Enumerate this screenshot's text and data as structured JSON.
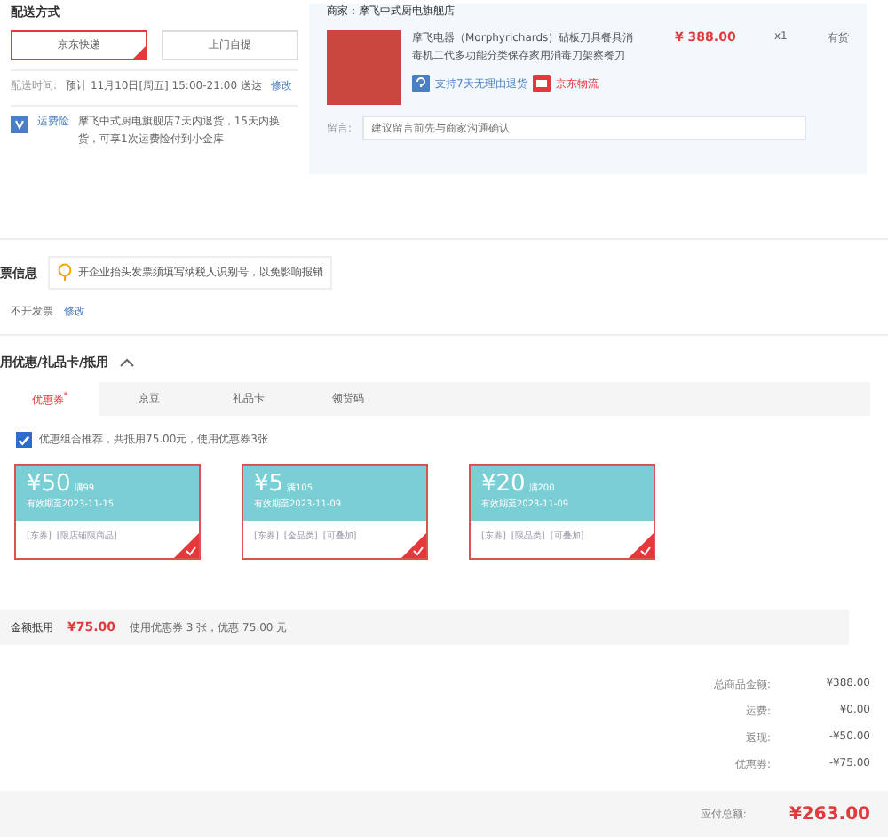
{
  "delivery": {
    "title": "配送方式",
    "methods": [
      {
        "label": "京东快递",
        "selected": true
      },
      {
        "label": "上门自提",
        "selected": false
      }
    ],
    "time_label": "配送时间:",
    "time_value": "预计 11月10日[周五] 15:00-21:00 送达",
    "time_edit": "修改",
    "insurance_label": "运费险",
    "insurance_text": "摩飞中式厨电旗舰店7天内退货，15天内换货，可享1次运费险付到小金库"
  },
  "shop": {
    "seller": "商家：摩飞中式厨电旗舰店",
    "product": {
      "title": "摩飞电器（Morphyrichards）砧板刀具餐具消毒机二代多功能分类保存家用消毒刀架察餐刀",
      "price": "¥ 388.00",
      "qty": "x1",
      "stock": "有货",
      "return_policy": "支持7天无理由退货",
      "logistics": "京东物流"
    },
    "message_label": "留言:",
    "message_placeholder": "建议留言前先与商家沟通确认"
  },
  "invoice": {
    "title": "票信息",
    "tip": "开企业抬头发票须填写纳税人识别号，以免影响报销",
    "value": "不开发票",
    "edit": "修改"
  },
  "discounts": {
    "title": "用优惠/礼品卡/抵用",
    "tabs": [
      {
        "label": "优惠券",
        "selected": true,
        "mark": "*"
      },
      {
        "label": "京豆",
        "selected": false
      },
      {
        "label": "礼品卡",
        "selected": false
      },
      {
        "label": "领货码",
        "selected": false
      }
    ],
    "combo": {
      "checked": true,
      "label": "优惠组合推荐，共抵用75.00元，使用优惠券3张"
    },
    "coupons": [
      {
        "amount": "¥50",
        "threshold": "满99",
        "valid": "有效期至2023-11-15",
        "tags": [
          "[东券]",
          "[限店铺限商品]"
        ],
        "selected": true
      },
      {
        "amount": "¥5",
        "threshold": "满105",
        "valid": "有效期至2023-11-09",
        "tags": [
          "[东券]",
          "[全品类]",
          "[可叠加]"
        ],
        "selected": true
      },
      {
        "amount": "¥20",
        "threshold": "满200",
        "valid": "有效期至2023-11-09",
        "tags": [
          "[东券]",
          "[限品类]",
          "[可叠加]"
        ],
        "selected": true
      }
    ],
    "summary_label": "金额抵用",
    "summary_amount": "¥75.00",
    "summary_text": "使用优惠券 3 张，优惠 75.00 元"
  },
  "totals": {
    "rows": [
      {
        "label": "总商品金额:",
        "value": "¥388.00"
      },
      {
        "label": "运费:",
        "value": "¥0.00"
      },
      {
        "label": "返现:",
        "value": "-¥50.00"
      },
      {
        "label": "优惠券:",
        "value": "-¥75.00"
      }
    ],
    "pay_label": "应付总额:",
    "pay_value": "¥263.00"
  }
}
